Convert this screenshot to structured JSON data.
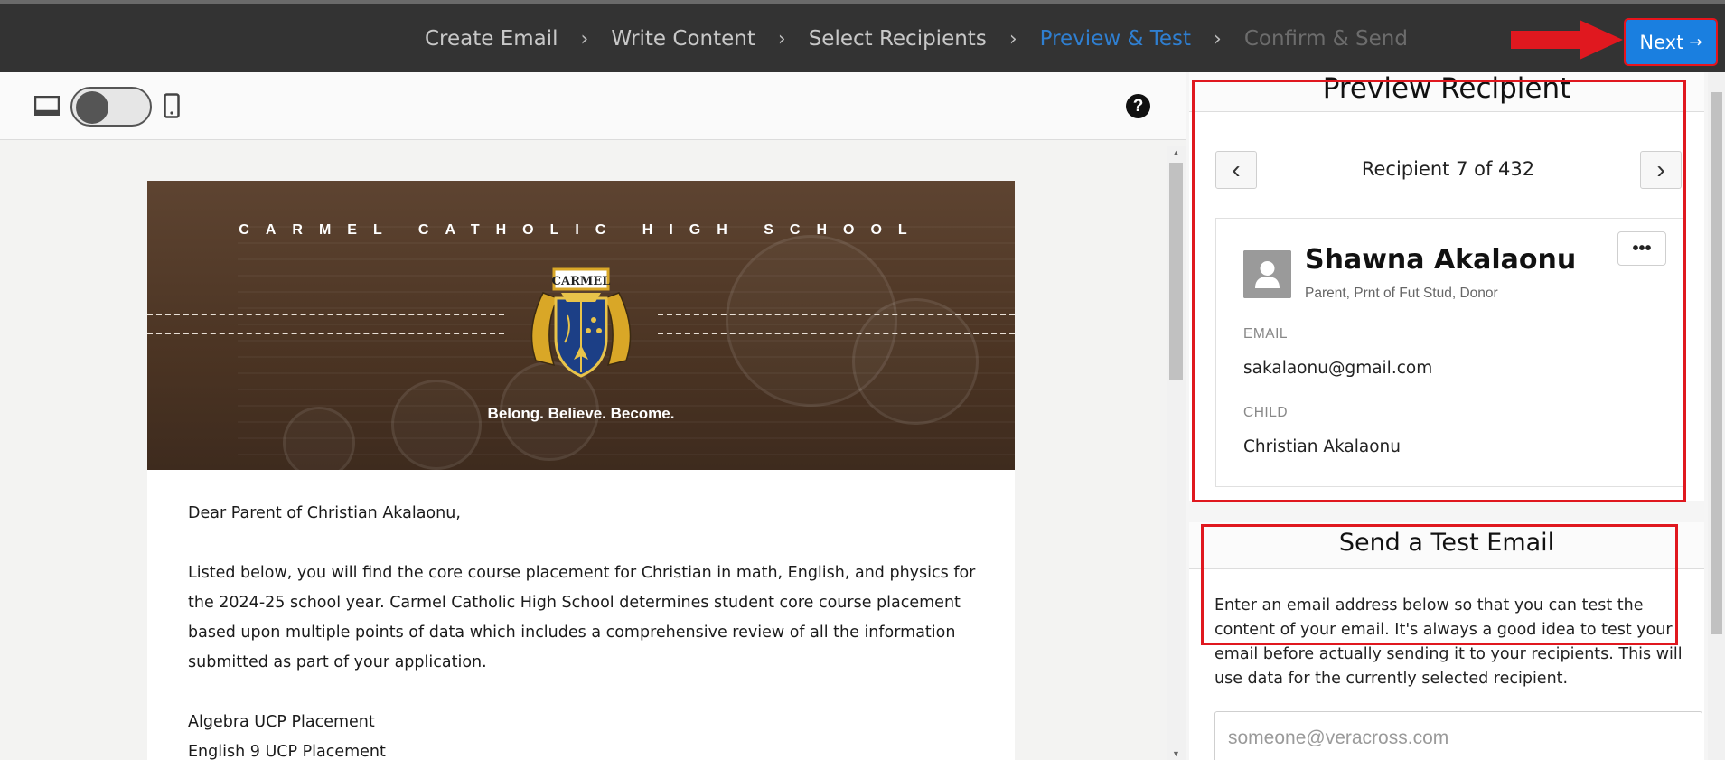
{
  "wizard": {
    "steps": [
      {
        "label": "Create Email",
        "state": "done"
      },
      {
        "label": "Write Content",
        "state": "done"
      },
      {
        "label": "Select Recipients",
        "state": "done"
      },
      {
        "label": "Preview & Test",
        "state": "active"
      },
      {
        "label": "Confirm & Send",
        "state": "disabled"
      }
    ],
    "next_label": "Next",
    "next_arrow": "→"
  },
  "toolbar": {
    "desktop_icon": "desktop-icon",
    "phone_icon": "mobile-phone-icon",
    "help_glyph": "?"
  },
  "email": {
    "school_name": "CARMEL CATHOLIC HIGH SCHOOL",
    "crest_text": "CARMEL",
    "tagline": "Belong. Believe. Become.",
    "greeting": "Dear Parent of Christian Akalaonu,",
    "paragraph": "Listed below, you will find the core course placement for Christian in math, English, and physics for the 2024-25 school year. Carmel Catholic High School determines student core course placement based upon multiple points of data which includes a comprehensive review of all the information submitted as part of your application.",
    "placements": [
      "Algebra UCP Placement",
      "English 9 UCP Placement"
    ]
  },
  "preview_recipient": {
    "title": "Preview Recipient",
    "counter": "Recipient 7 of 432",
    "prev_glyph": "‹",
    "next_glyph": "›",
    "contact": {
      "name": "Shawna Akalaonu",
      "roles": "Parent, Prnt of Fut Stud, Donor",
      "email_label": "EMAIL",
      "email": "sakalaonu@gmail.com",
      "child_label": "CHILD",
      "child": "Christian Akalaonu",
      "more_glyph": "•••"
    }
  },
  "test_email": {
    "title": "Send a Test Email",
    "description": "Enter an email address below so that you can test the content of your email. It's always a good idea to test your email before actually sending it to your recipients. This will use data for the currently selected recipient.",
    "placeholder": "someone@veracross.com"
  },
  "colors": {
    "topbar": "#333333",
    "accent_blue": "#1a7fe0",
    "active_step": "#2f7fd1",
    "annotation_red": "#e0181f"
  }
}
